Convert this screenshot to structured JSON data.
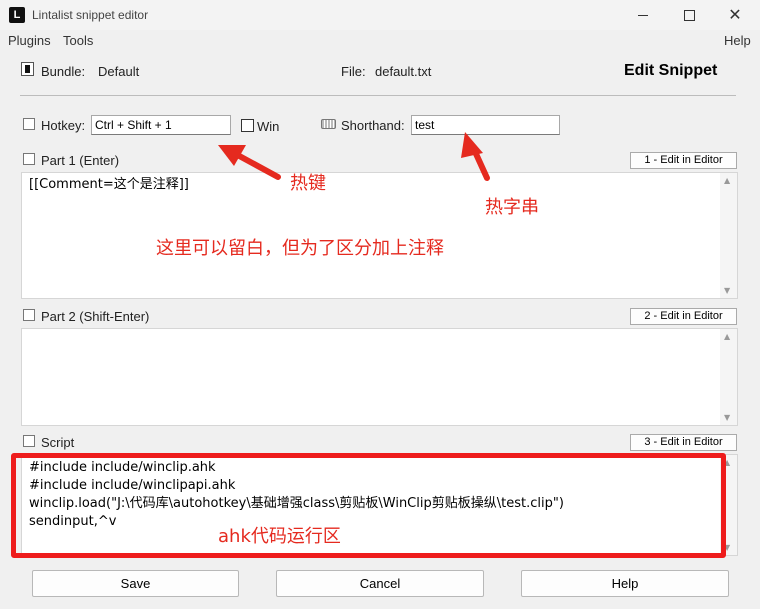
{
  "window": {
    "app_icon_letter": "L",
    "title": "Lintalist snippet editor",
    "close_glyph": "✕"
  },
  "menu": {
    "plugins": "Plugins",
    "tools": "Tools",
    "help": "Help"
  },
  "header": {
    "bundle_label": "Bundle:",
    "bundle_value": "Default",
    "file_label": "File:",
    "file_value": "default.txt",
    "heading": "Edit Snippet"
  },
  "hotkey": {
    "label": "Hotkey:",
    "value": "Ctrl + Shift + 1",
    "win_label": "Win",
    "win_checked": false
  },
  "shorthand": {
    "label": "Shorthand:",
    "value": "test"
  },
  "part1": {
    "label": "Part 1 (Enter)",
    "edit_button": "1 - Edit in Editor",
    "content": "[[Comment=这个是注释]]"
  },
  "part2": {
    "label": "Part 2 (Shift-Enter)",
    "edit_button": "2 - Edit in Editor",
    "content": ""
  },
  "script": {
    "label": "Script",
    "edit_button": "3 - Edit in Editor",
    "content": "#include include/winclip.ahk\n#include include/winclipapi.ahk\nwinclip.load(\"J:\\代码库\\autohotkey\\基础增强class\\剪贴板\\WinClip剪贴板操纵\\test.clip\")\nsendinput,^v"
  },
  "buttons": {
    "save": "Save",
    "cancel": "Cancel",
    "help": "Help"
  },
  "annotations": {
    "hotkey": "热键",
    "shorthand": "热字串",
    "part1_note": "这里可以留白，但为了区分加上注释",
    "script_area": "ahk代码运行区"
  },
  "colors": {
    "annotation_red": "#e52a1f"
  },
  "icons": [
    "app-icon",
    "minimize-icon",
    "maximize-icon",
    "close-icon",
    "bundle-icon",
    "hotkey-icon",
    "keyboard-icon",
    "part1-icon",
    "part2-icon",
    "script-icon",
    "scroll-up-icon",
    "scroll-down-icon",
    "arrow-icon"
  ]
}
